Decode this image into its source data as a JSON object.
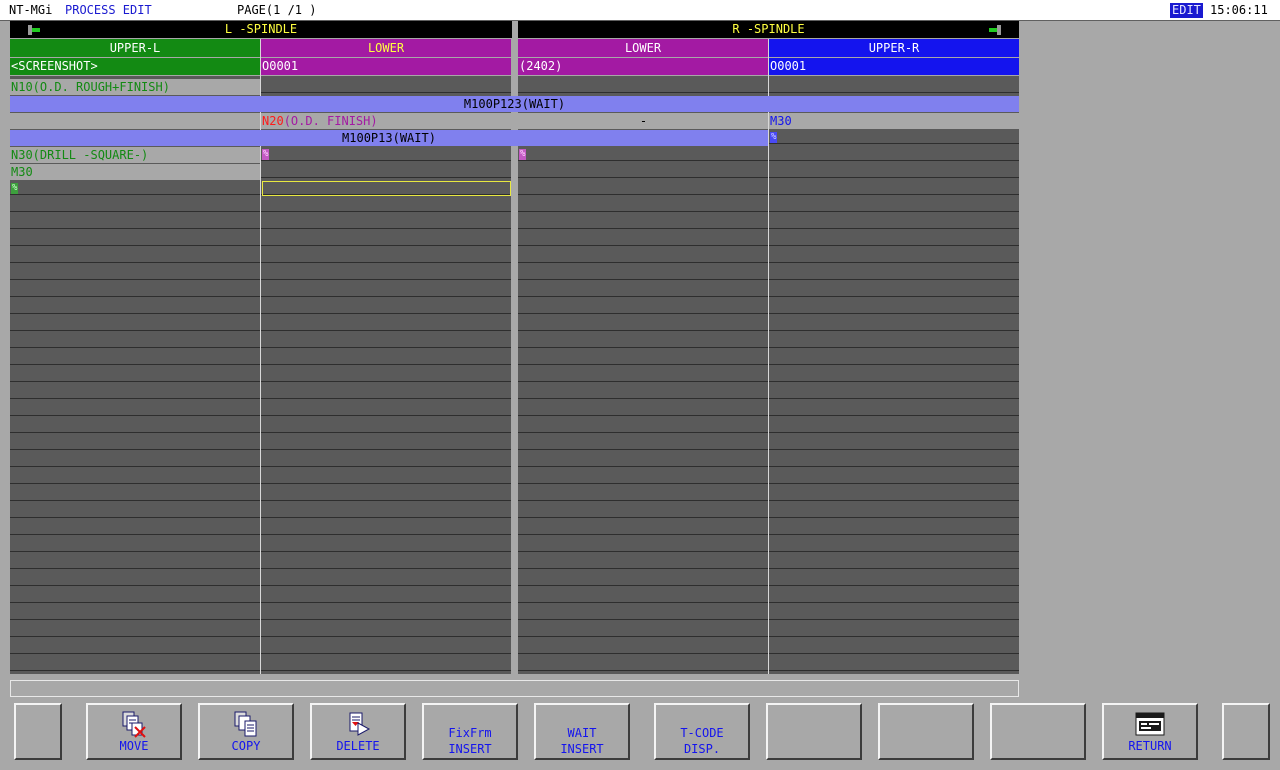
{
  "titlebar": {
    "app": "NT-MGi",
    "screen": "PROCESS EDIT",
    "page": "PAGE(1 /1 )",
    "mode": "EDIT",
    "time": "15:06:11"
  },
  "spindles": {
    "left": "L -SPINDLE",
    "right": "R -SPINDLE"
  },
  "columns": [
    {
      "header": "UPPER-L",
      "program": "<SCREENSHOT>"
    },
    {
      "header": "LOWER",
      "program": "O0001"
    },
    {
      "header": "LOWER",
      "program": "(2402)"
    },
    {
      "header": "UPPER-R",
      "program": "O0001"
    }
  ],
  "process": {
    "c0_row1": "N10(O.D. ROUGH+FINISH)",
    "wait1": "M100P123(WAIT)",
    "c1_row3_n": "N20",
    "c1_row3_text": "(O.D. FINISH)",
    "c2_row3": "-",
    "c3_row3": "M30",
    "wait2": "M100P13(WAIT)",
    "c3_row4_pct": "%",
    "c0_row5": "N30(DRILL -SQUARE-)",
    "c1_row5_pct": "%",
    "c2_row5_pct": "%",
    "c0_row6": "M30",
    "c0_row7_pct": "%"
  },
  "softkeys": [
    {
      "label": "",
      "icon": ""
    },
    {
      "label": "MOVE",
      "icon": "move-icon"
    },
    {
      "label": "COPY",
      "icon": "copy-icon"
    },
    {
      "label": "DELETE",
      "icon": "delete-icon"
    },
    {
      "label": "FixFrm",
      "label2": "INSERT"
    },
    {
      "label": "WAIT",
      "label2": "INSERT"
    },
    {
      "label": "T-CODE",
      "label2": "DISP."
    },
    {
      "label": ""
    },
    {
      "label": ""
    },
    {
      "label": ""
    },
    {
      "label": "RETURN",
      "icon": "return-icon"
    },
    {
      "label": ""
    }
  ]
}
